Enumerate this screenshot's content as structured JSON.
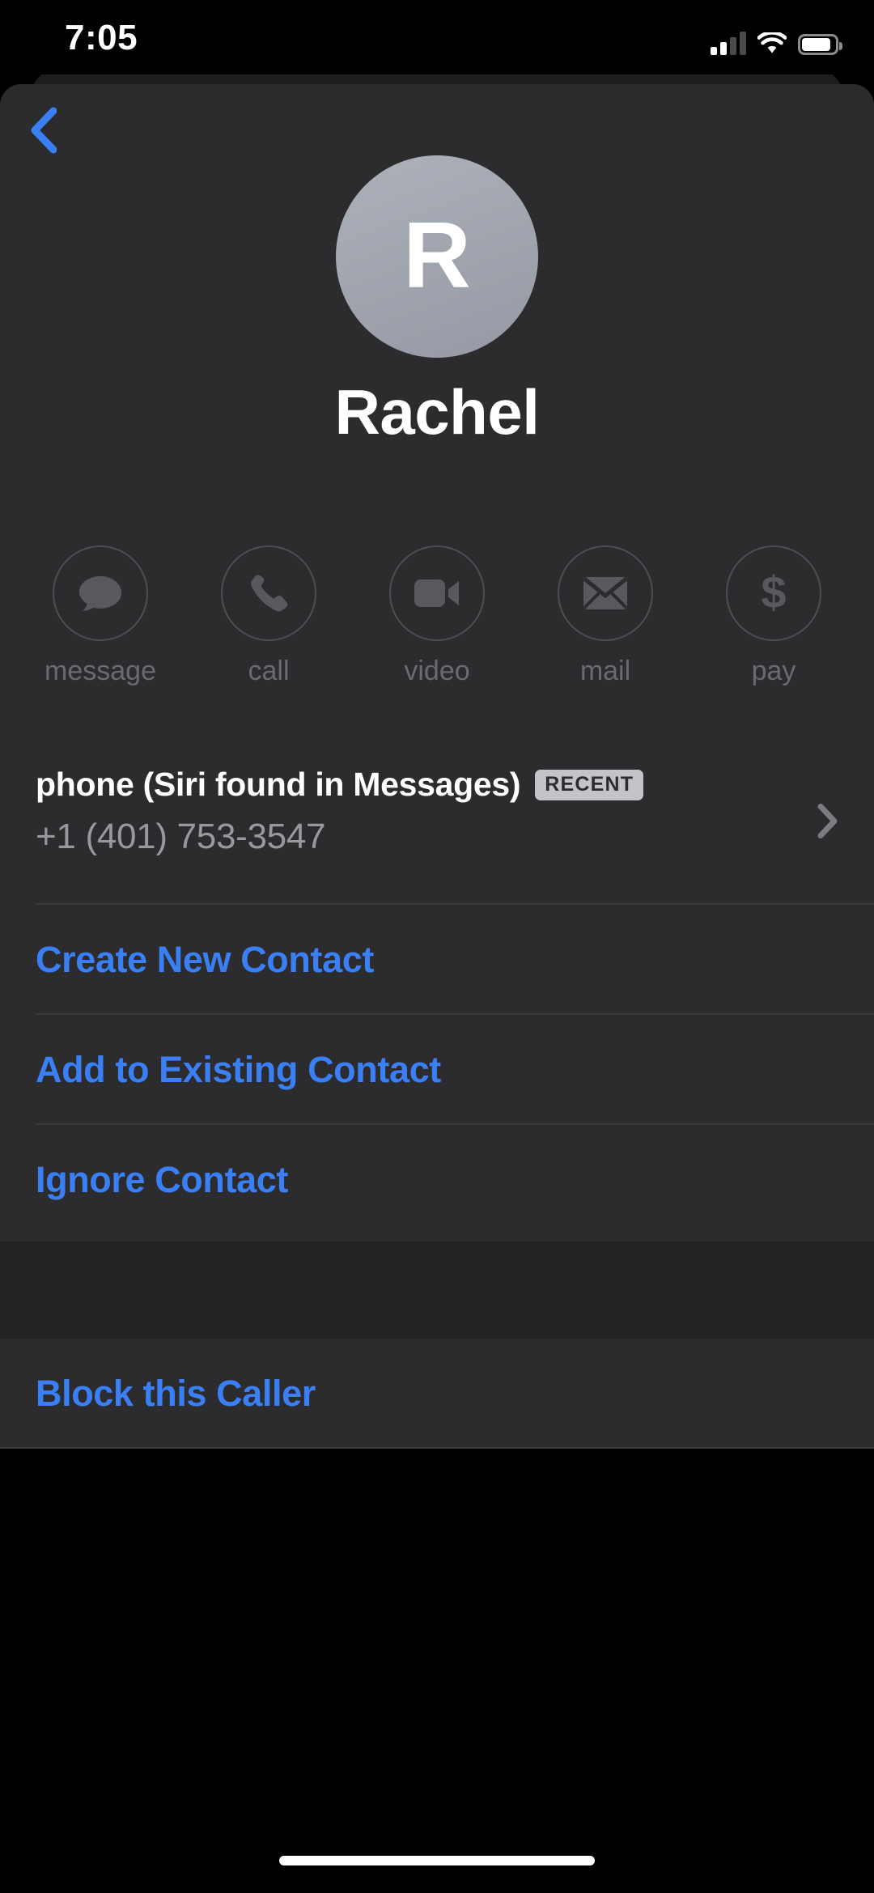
{
  "status_bar": {
    "time": "7:05",
    "cellular_icon": "signal-bars-icon",
    "signal_bars_filled": 2,
    "signal_bars_total": 4,
    "wifi_icon": "wifi-icon",
    "battery_icon": "battery-icon",
    "battery_level_percent": 85
  },
  "navigation": {
    "back_icon": "chevron-left-icon",
    "back_color": "#3b7ff5"
  },
  "contact": {
    "avatar_initial": "R",
    "avatar_icon": "avatar-monogram",
    "avatar_color": "#9fa3ad",
    "name": "Rachel"
  },
  "actions": [
    {
      "label": "message",
      "icon": "message-bubble-icon"
    },
    {
      "label": "call",
      "icon": "phone-handset-icon"
    },
    {
      "label": "video",
      "icon": "video-camera-icon"
    },
    {
      "label": "mail",
      "icon": "envelope-icon"
    },
    {
      "label": "pay",
      "icon": "dollar-sign-icon"
    }
  ],
  "phone_entry": {
    "label": "phone (Siri found in Messages)",
    "badge": "RECENT",
    "number": "+1 (401) 753-3547",
    "disclosure_icon": "chevron-right-icon"
  },
  "contact_actions": [
    {
      "label": "Create New Contact"
    },
    {
      "label": "Add to Existing Contact"
    },
    {
      "label": "Ignore Contact"
    }
  ],
  "block_action": {
    "label": "Block this Caller"
  },
  "colors": {
    "accent_blue": "#3b7ff5",
    "card_background": "#2c2c2e",
    "page_background": "#000000",
    "separator": "#3a3a3c",
    "secondary_text": "#98989d",
    "disabled_text": "#6a6a6f",
    "badge_background": "#c4c4c8"
  },
  "home_indicator": {
    "icon": "home-indicator"
  }
}
